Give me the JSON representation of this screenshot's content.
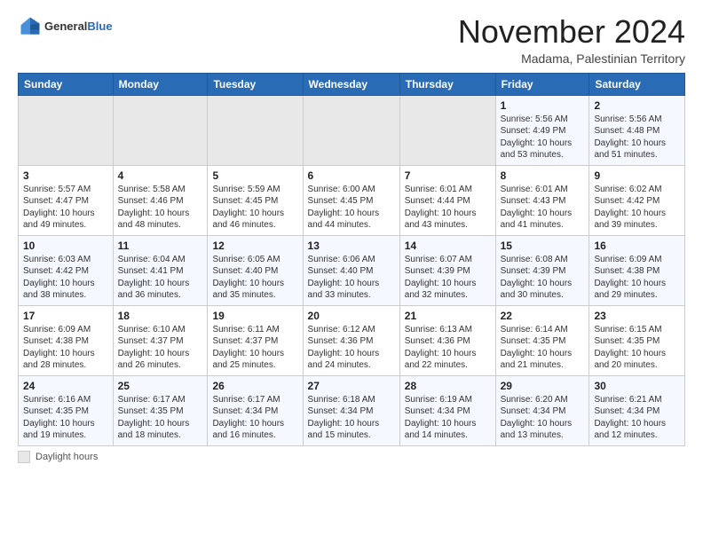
{
  "header": {
    "logo_general": "General",
    "logo_blue": "Blue",
    "month_title": "November 2024",
    "location": "Madama, Palestinian Territory"
  },
  "days_of_week": [
    "Sunday",
    "Monday",
    "Tuesday",
    "Wednesday",
    "Thursday",
    "Friday",
    "Saturday"
  ],
  "legend_label": "Daylight hours",
  "weeks": [
    [
      {
        "day": "",
        "info": ""
      },
      {
        "day": "",
        "info": ""
      },
      {
        "day": "",
        "info": ""
      },
      {
        "day": "",
        "info": ""
      },
      {
        "day": "",
        "info": ""
      },
      {
        "day": "1",
        "info": "Sunrise: 5:56 AM\nSunset: 4:49 PM\nDaylight: 10 hours\nand 53 minutes."
      },
      {
        "day": "2",
        "info": "Sunrise: 5:56 AM\nSunset: 4:48 PM\nDaylight: 10 hours\nand 51 minutes."
      }
    ],
    [
      {
        "day": "3",
        "info": "Sunrise: 5:57 AM\nSunset: 4:47 PM\nDaylight: 10 hours\nand 49 minutes."
      },
      {
        "day": "4",
        "info": "Sunrise: 5:58 AM\nSunset: 4:46 PM\nDaylight: 10 hours\nand 48 minutes."
      },
      {
        "day": "5",
        "info": "Sunrise: 5:59 AM\nSunset: 4:45 PM\nDaylight: 10 hours\nand 46 minutes."
      },
      {
        "day": "6",
        "info": "Sunrise: 6:00 AM\nSunset: 4:45 PM\nDaylight: 10 hours\nand 44 minutes."
      },
      {
        "day": "7",
        "info": "Sunrise: 6:01 AM\nSunset: 4:44 PM\nDaylight: 10 hours\nand 43 minutes."
      },
      {
        "day": "8",
        "info": "Sunrise: 6:01 AM\nSunset: 4:43 PM\nDaylight: 10 hours\nand 41 minutes."
      },
      {
        "day": "9",
        "info": "Sunrise: 6:02 AM\nSunset: 4:42 PM\nDaylight: 10 hours\nand 39 minutes."
      }
    ],
    [
      {
        "day": "10",
        "info": "Sunrise: 6:03 AM\nSunset: 4:42 PM\nDaylight: 10 hours\nand 38 minutes."
      },
      {
        "day": "11",
        "info": "Sunrise: 6:04 AM\nSunset: 4:41 PM\nDaylight: 10 hours\nand 36 minutes."
      },
      {
        "day": "12",
        "info": "Sunrise: 6:05 AM\nSunset: 4:40 PM\nDaylight: 10 hours\nand 35 minutes."
      },
      {
        "day": "13",
        "info": "Sunrise: 6:06 AM\nSunset: 4:40 PM\nDaylight: 10 hours\nand 33 minutes."
      },
      {
        "day": "14",
        "info": "Sunrise: 6:07 AM\nSunset: 4:39 PM\nDaylight: 10 hours\nand 32 minutes."
      },
      {
        "day": "15",
        "info": "Sunrise: 6:08 AM\nSunset: 4:39 PM\nDaylight: 10 hours\nand 30 minutes."
      },
      {
        "day": "16",
        "info": "Sunrise: 6:09 AM\nSunset: 4:38 PM\nDaylight: 10 hours\nand 29 minutes."
      }
    ],
    [
      {
        "day": "17",
        "info": "Sunrise: 6:09 AM\nSunset: 4:38 PM\nDaylight: 10 hours\nand 28 minutes."
      },
      {
        "day": "18",
        "info": "Sunrise: 6:10 AM\nSunset: 4:37 PM\nDaylight: 10 hours\nand 26 minutes."
      },
      {
        "day": "19",
        "info": "Sunrise: 6:11 AM\nSunset: 4:37 PM\nDaylight: 10 hours\nand 25 minutes."
      },
      {
        "day": "20",
        "info": "Sunrise: 6:12 AM\nSunset: 4:36 PM\nDaylight: 10 hours\nand 24 minutes."
      },
      {
        "day": "21",
        "info": "Sunrise: 6:13 AM\nSunset: 4:36 PM\nDaylight: 10 hours\nand 22 minutes."
      },
      {
        "day": "22",
        "info": "Sunrise: 6:14 AM\nSunset: 4:35 PM\nDaylight: 10 hours\nand 21 minutes."
      },
      {
        "day": "23",
        "info": "Sunrise: 6:15 AM\nSunset: 4:35 PM\nDaylight: 10 hours\nand 20 minutes."
      }
    ],
    [
      {
        "day": "24",
        "info": "Sunrise: 6:16 AM\nSunset: 4:35 PM\nDaylight: 10 hours\nand 19 minutes."
      },
      {
        "day": "25",
        "info": "Sunrise: 6:17 AM\nSunset: 4:35 PM\nDaylight: 10 hours\nand 18 minutes."
      },
      {
        "day": "26",
        "info": "Sunrise: 6:17 AM\nSunset: 4:34 PM\nDaylight: 10 hours\nand 16 minutes."
      },
      {
        "day": "27",
        "info": "Sunrise: 6:18 AM\nSunset: 4:34 PM\nDaylight: 10 hours\nand 15 minutes."
      },
      {
        "day": "28",
        "info": "Sunrise: 6:19 AM\nSunset: 4:34 PM\nDaylight: 10 hours\nand 14 minutes."
      },
      {
        "day": "29",
        "info": "Sunrise: 6:20 AM\nSunset: 4:34 PM\nDaylight: 10 hours\nand 13 minutes."
      },
      {
        "day": "30",
        "info": "Sunrise: 6:21 AM\nSunset: 4:34 PM\nDaylight: 10 hours\nand 12 minutes."
      }
    ]
  ]
}
